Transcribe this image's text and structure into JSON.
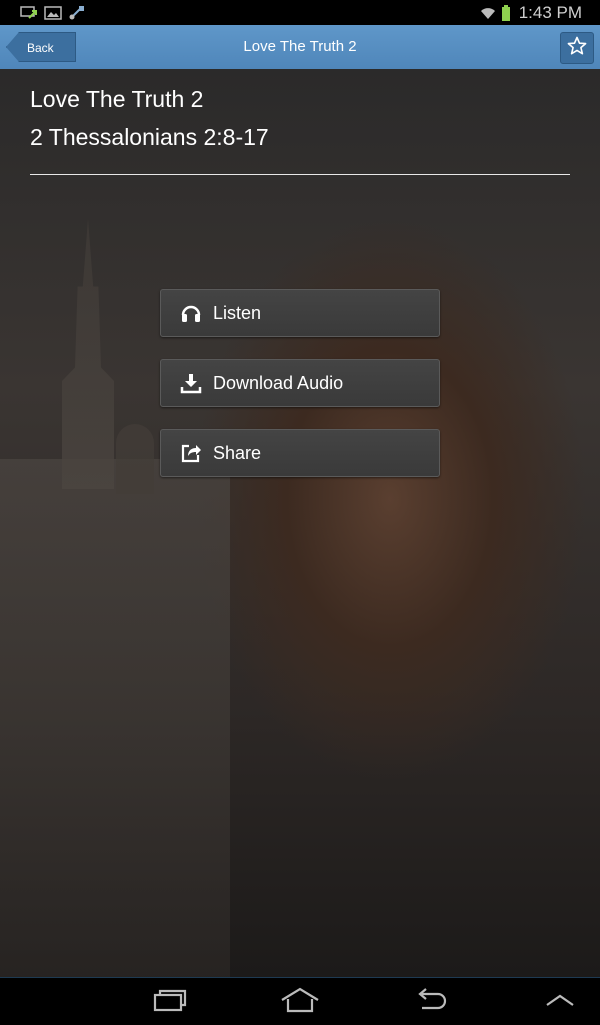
{
  "status_bar": {
    "time": "1:43 PM",
    "left_icons": [
      "screen-mirroring-icon",
      "image-icon",
      "usb-icon"
    ],
    "right_icons": [
      "wifi-icon",
      "battery-icon"
    ]
  },
  "action_bar": {
    "back_label": "Back",
    "title": "Love The Truth 2",
    "favorite_icon": "star-icon",
    "accent_color": "#5a92c4"
  },
  "sermon": {
    "title": "Love The Truth 2",
    "scripture": "2 Thessalonians 2:8-17"
  },
  "actions": [
    {
      "label": "Listen",
      "icon": "headphones-icon"
    },
    {
      "label": "Download Audio",
      "icon": "download-icon"
    },
    {
      "label": "Share",
      "icon": "share-icon"
    }
  ],
  "nav_bar": {
    "icons": [
      "recent-apps-icon",
      "home-icon",
      "back-nav-icon",
      "expand-up-icon"
    ]
  }
}
